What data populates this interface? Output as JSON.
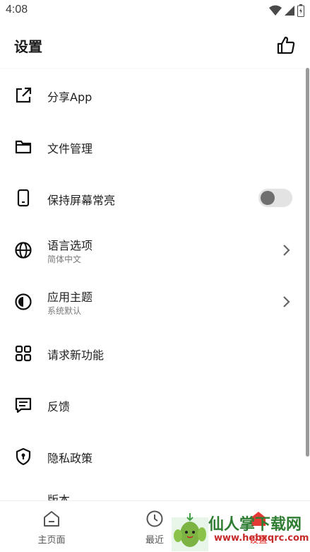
{
  "status_bar": {
    "time": "4:08"
  },
  "app_bar": {
    "title": "设置"
  },
  "settings": [
    {
      "label": "分享App",
      "icon": "share-external-icon"
    },
    {
      "label": "文件管理",
      "icon": "folder-icon"
    },
    {
      "label": "保持屏幕常亮",
      "icon": "phone-icon",
      "toggle_on": false
    },
    {
      "label": "语言选项",
      "subtitle": "简体中文",
      "icon": "globe-icon"
    },
    {
      "label": "应用主题",
      "subtitle": "系统默认",
      "icon": "theme-contrast-icon"
    },
    {
      "label": "请求新功能",
      "icon": "grid-apps-icon"
    },
    {
      "label": "反馈",
      "icon": "feedback-message-icon"
    },
    {
      "label": "隐私政策",
      "icon": "privacy-shield-icon"
    },
    {
      "label": "版本"
    }
  ],
  "bottom_nav": {
    "items": [
      {
        "label": "主页面",
        "icon": "home-icon"
      },
      {
        "label": "最近",
        "icon": "clock-icon"
      },
      {
        "label": "设置",
        "icon": "settings-icon",
        "active": true
      }
    ]
  },
  "watermark": {
    "text": "仙人掌下载网",
    "url": "www.hebxqrc.com"
  },
  "colors": {
    "background": "#ffffff",
    "list_background": "#fafafa",
    "text": "#1f1f1f",
    "secondary_text": "#7a7a7a",
    "active": "#e53935",
    "watermark_green": "#2e7d32"
  }
}
